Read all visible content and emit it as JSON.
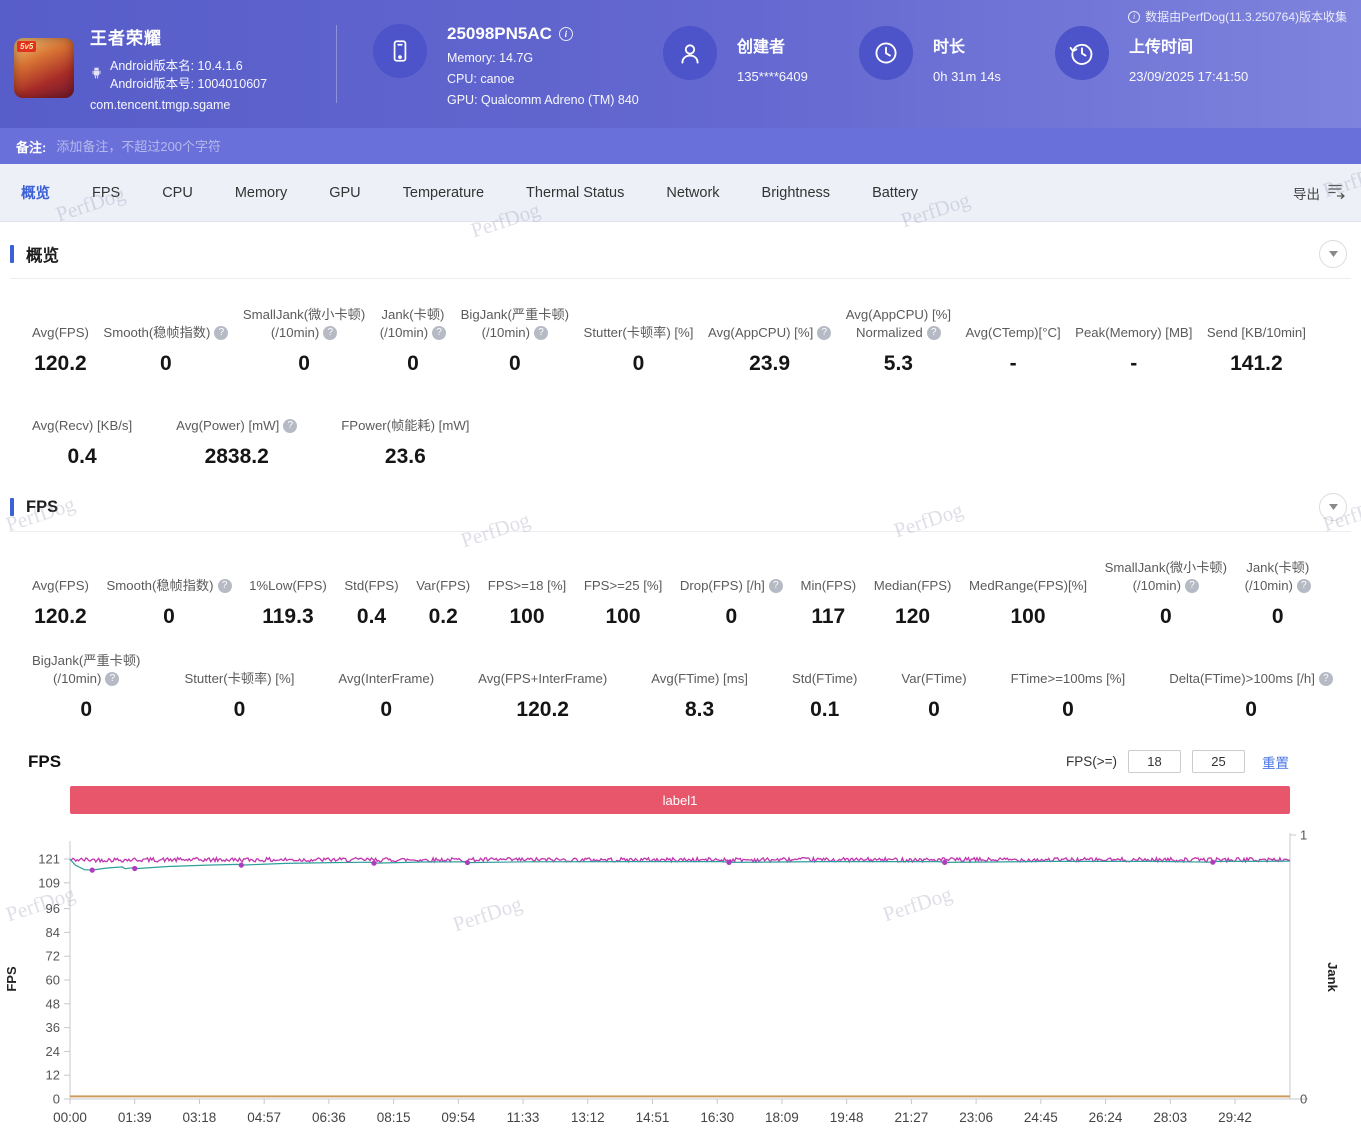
{
  "watermark": "PerfDog",
  "header": {
    "app": {
      "badge": "5v5",
      "title": "王者荣耀",
      "android_version_name": "Android版本名: 10.4.1.6",
      "android_version_code": "Android版本号: 1004010607",
      "package": "com.tencent.tmgp.sgame"
    },
    "device": {
      "name": "25098PN5AC",
      "memory": "Memory: 14.7G",
      "cpu": "CPU: canoe",
      "gpu": "GPU: Qualcomm Adreno (TM) 840"
    },
    "creator": {
      "label": "创建者",
      "value": "135****6409"
    },
    "duration": {
      "label": "时长",
      "value": "0h 31m 14s"
    },
    "upload": {
      "label": "上传时间",
      "value": "23/09/2025 17:41:50"
    },
    "collect_info": "数据由PerfDog(11.3.250764)版本收集"
  },
  "note": {
    "label": "备注:",
    "placeholder": "添加备注，不超过200个字符"
  },
  "nav": {
    "tabs": [
      {
        "label": "概览",
        "active": true
      },
      {
        "label": "FPS",
        "active": false
      },
      {
        "label": "CPU",
        "active": false
      },
      {
        "label": "Memory",
        "active": false
      },
      {
        "label": "GPU",
        "active": false
      },
      {
        "label": "Temperature",
        "active": false
      },
      {
        "label": "Thermal Status",
        "active": false
      },
      {
        "label": "Network",
        "active": false
      },
      {
        "label": "Brightness",
        "active": false
      },
      {
        "label": "Battery",
        "active": false
      }
    ],
    "export_label": "导出"
  },
  "overview": {
    "title": "概览",
    "row1": [
      {
        "label": "Avg(FPS)",
        "value": "120.2"
      },
      {
        "label": "Smooth(稳帧指数)",
        "help": true,
        "value": "0"
      },
      {
        "label": "SmallJank(微小卡顿)\n(/10min)",
        "help": true,
        "value": "0"
      },
      {
        "label": "Jank(卡顿)\n(/10min)",
        "help": true,
        "value": "0"
      },
      {
        "label": "BigJank(严重卡顿)\n(/10min)",
        "help": true,
        "value": "0"
      },
      {
        "label": "Stutter(卡顿率) [%]",
        "value": "0"
      },
      {
        "label": "Avg(AppCPU) [%]",
        "help": true,
        "value": "23.9"
      },
      {
        "label": "Avg(AppCPU) [%]\nNormalized",
        "help": true,
        "value": "5.3"
      },
      {
        "label": "Avg(CTemp)[°C]",
        "value": "-"
      },
      {
        "label": "Peak(Memory) [MB]",
        "value": "-"
      },
      {
        "label": "Send [KB/10min]",
        "value": "141.2"
      }
    ],
    "row2": [
      {
        "label": "Avg(Recv) [KB/s]",
        "value": "0.4"
      },
      {
        "label": "Avg(Power) [mW]",
        "help": true,
        "value": "2838.2"
      },
      {
        "label": "FPower(帧能耗) [mW]",
        "value": "23.6"
      }
    ]
  },
  "fps_section": {
    "title": "FPS",
    "row1": [
      {
        "label": "Avg(FPS)",
        "value": "120.2"
      },
      {
        "label": "Smooth(稳帧指数)",
        "help": true,
        "value": "0"
      },
      {
        "label": "1%Low(FPS)",
        "value": "119.3"
      },
      {
        "label": "Std(FPS)",
        "value": "0.4"
      },
      {
        "label": "Var(FPS)",
        "value": "0.2"
      },
      {
        "label": "FPS>=18 [%]",
        "value": "100"
      },
      {
        "label": "FPS>=25 [%]",
        "value": "100"
      },
      {
        "label": "Drop(FPS) [/h]",
        "help": true,
        "value": "0"
      },
      {
        "label": "Min(FPS)",
        "value": "117"
      },
      {
        "label": "Median(FPS)",
        "value": "120"
      },
      {
        "label": "MedRange(FPS)[%]",
        "value": "100"
      },
      {
        "label": "SmallJank(微小卡顿)\n(/10min)",
        "help": true,
        "value": "0"
      },
      {
        "label": "Jank(卡顿)\n(/10min)",
        "help": true,
        "value": "0"
      }
    ],
    "row2": [
      {
        "label": "BigJank(严重卡顿)\n(/10min)",
        "help": true,
        "value": "0"
      },
      {
        "label": "Stutter(卡顿率) [%]",
        "value": "0"
      },
      {
        "label": "Avg(InterFrame)",
        "value": "0"
      },
      {
        "label": "Avg(FPS+InterFrame)",
        "value": "120.2"
      },
      {
        "label": "Avg(FTime) [ms]",
        "value": "8.3"
      },
      {
        "label": "Std(FTime)",
        "value": "0.1"
      },
      {
        "label": "Var(FTime)",
        "value": "0"
      },
      {
        "label": "FTime>=100ms [%]",
        "value": "0"
      },
      {
        "label": "Delta(FTime)>100ms [/h]",
        "help": true,
        "value": "0"
      }
    ]
  },
  "fps_chart": {
    "title": "FPS",
    "threshold_label": "FPS(>=)",
    "threshold_low": "18",
    "threshold_high": "25",
    "reset_label": "重置"
  },
  "chart_data": {
    "type": "line",
    "banner_label": "label1",
    "x_ticks": [
      "00:00",
      "01:39",
      "03:18",
      "04:57",
      "06:36",
      "08:15",
      "09:54",
      "11:33",
      "13:12",
      "14:51",
      "16:30",
      "18:09",
      "19:48",
      "21:27",
      "23:06",
      "24:45",
      "26:24",
      "28:03",
      "29:42"
    ],
    "tick_interval_sec": 99,
    "duration_sec": 1866,
    "y_left": {
      "label": "FPS",
      "ticks": [
        0,
        12,
        24,
        36,
        48,
        60,
        72,
        84,
        96,
        109,
        121
      ],
      "max": 121
    },
    "y_right": {
      "label": "Jank",
      "ticks": [
        0,
        1
      ],
      "max": 1
    },
    "series": [
      {
        "name": "FPS",
        "color": "#c136ae",
        "style": "noisy",
        "baseline": 120.6,
        "noise": 1.1,
        "seed": 42,
        "points_count": 850,
        "width": 1.3
      },
      {
        "name": "FPS-trend",
        "color": "#2f9e9c",
        "style": "line",
        "width": 1.2,
        "points": [
          [
            0,
            120.9
          ],
          [
            8,
            118.0
          ],
          [
            22,
            115.6
          ],
          [
            34,
            115.4
          ],
          [
            55,
            116.4
          ],
          [
            80,
            117.0
          ],
          [
            84,
            116.1
          ],
          [
            99,
            116.7
          ],
          [
            104,
            116.2
          ],
          [
            150,
            117.2
          ],
          [
            210,
            117.9
          ],
          [
            256,
            118.3
          ],
          [
            262,
            117.9
          ],
          [
            330,
            118.8
          ],
          [
            400,
            119.2
          ],
          [
            459,
            119.4
          ],
          [
            465,
            118.9
          ],
          [
            540,
            119.5
          ],
          [
            601,
            119.6
          ],
          [
            608,
            119.2
          ],
          [
            700,
            119.6
          ],
          [
            860,
            119.7
          ],
          [
            999,
            119.7
          ],
          [
            1008,
            119.3
          ],
          [
            1150,
            119.7
          ],
          [
            1328,
            119.7
          ],
          [
            1338,
            119.3
          ],
          [
            1500,
            119.8
          ],
          [
            1660,
            119.8
          ],
          [
            1745,
            119.4
          ],
          [
            1755,
            119.8
          ],
          [
            1866,
            119.9
          ]
        ]
      },
      {
        "name": "Jank",
        "color": "#cf9a5e",
        "style": "line",
        "axis": "right",
        "width": 2,
        "points": [
          [
            0,
            0.01
          ],
          [
            1866,
            0.01
          ]
        ]
      }
    ],
    "markers": {
      "color": "#b13bbd",
      "points": [
        [
          34,
          115.4
        ],
        [
          99,
          116.2
        ],
        [
          262,
          117.9
        ],
        [
          465,
          118.9
        ],
        [
          608,
          119.2
        ],
        [
          1008,
          119.3
        ],
        [
          1338,
          119.3
        ],
        [
          1748,
          119.4
        ]
      ]
    }
  }
}
